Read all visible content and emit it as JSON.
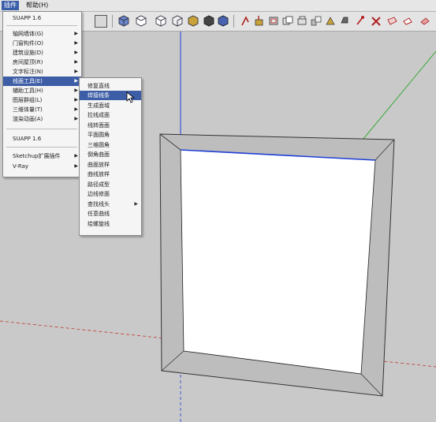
{
  "menubar": {
    "items": [
      {
        "label": "插件"
      },
      {
        "label": "帮助(H)"
      }
    ]
  },
  "toolbar": {
    "icons": [
      "window-icon",
      "iso-view-icon",
      "top-view-icon",
      "front-view-icon",
      "right-view-icon",
      "back-view-icon",
      "left-view-icon",
      "xray-icon",
      "wireframe-icon",
      "hidden-line-icon",
      "shaded-icon",
      "textured-icon",
      "monochrome-icon",
      "follow-me-icon",
      "push-pull-icon",
      "offset-icon",
      "move-icon",
      "rotate-icon",
      "scale-icon",
      "tape-icon",
      "protractor-icon",
      "dimension-icon",
      "text-icon"
    ]
  },
  "plugins_menu": {
    "header": "SUAPP 1.6",
    "items": [
      {
        "label": "轴网墙体(G)",
        "submenu": true
      },
      {
        "label": "门窗构件(O)",
        "submenu": true
      },
      {
        "label": "建筑设施(D)",
        "submenu": true
      },
      {
        "label": "房间屋顶(R)",
        "submenu": true
      },
      {
        "label": "文字标注(N)",
        "submenu": true
      },
      {
        "label": "线面工具(E)",
        "submenu": true,
        "highlighted": true
      },
      {
        "label": "辅助工具(H)",
        "submenu": true
      },
      {
        "label": "图层群组(L)",
        "submenu": true
      },
      {
        "label": "三维体量(T)",
        "submenu": true
      },
      {
        "label": "渲染动画(A)",
        "submenu": true
      }
    ],
    "footer_1": "SUAPP 1.6",
    "footer_2": [
      {
        "label": "Sketchup扩展插件",
        "submenu": true
      },
      {
        "label": "V-Ray",
        "submenu": true
      }
    ]
  },
  "line_tools_submenu": {
    "items": [
      {
        "label": "修复直线"
      },
      {
        "label": "焊接线条",
        "highlighted": true
      },
      {
        "label": "生成面域"
      },
      {
        "label": "拉线成面"
      },
      {
        "label": "线转面面"
      },
      {
        "label": "平面圆角"
      },
      {
        "label": "三维圆角"
      },
      {
        "label": "倒角曲面"
      },
      {
        "label": "曲面放样"
      },
      {
        "label": "曲线放样"
      },
      {
        "label": "路径成型"
      },
      {
        "label": "边线修面"
      },
      {
        "label": "查找线头",
        "submenu": true
      },
      {
        "label": "任意曲线"
      },
      {
        "label": "绘螺旋线"
      }
    ]
  },
  "colors": {
    "menu_highlight": "#3d5ea6",
    "viewport_bg": "#c9c9c9",
    "green_axis": "#3aa83a",
    "red_axis": "#c0392b",
    "blue_axis": "#1f3fd6"
  }
}
